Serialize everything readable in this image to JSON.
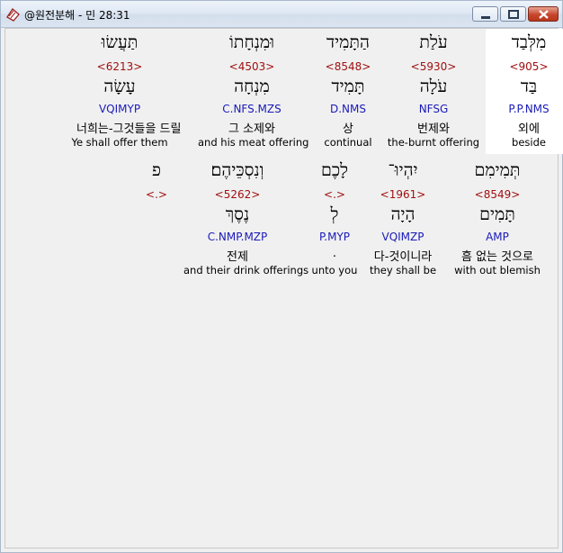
{
  "window": {
    "title": "@원전분해 - 민 28:31"
  },
  "row1": [
    {
      "heb": "מִלְּבַד",
      "num": "<905>",
      "lemma": "בַּד",
      "gram": "P.P.NMS",
      "kor": "외에",
      "eng": "beside"
    },
    {
      "heb": "עֹלַת",
      "num": "<5930>",
      "lemma": "עֹלָה",
      "gram": "NFSG",
      "kor": "번제와",
      "eng": "the-burnt offering"
    },
    {
      "heb": "הַתָּמִיד",
      "num": "<8548>",
      "lemma": "תָּמִיד",
      "gram": "D.NMS",
      "kor": "상",
      "eng": "continual"
    },
    {
      "heb": "וּמִנְחָתוֹ",
      "num": "<4503>",
      "lemma": "מִנְחָה",
      "gram": "C.NFS.MZS",
      "kor": "그 소제와",
      "eng": "and his meat offering"
    },
    {
      "heb": "תַּעֲשׂוּ",
      "num": "<6213>",
      "lemma": "עָשָׂה",
      "gram": "VQIMYP",
      "kor": "너희는-그것들을 드릴",
      "eng": "Ye shall offer them"
    }
  ],
  "row2": [
    {
      "heb": "תְּמִימִם",
      "num": "<8549>",
      "lemma": "תָּמִים",
      "gram": "AMP",
      "kor": "흠 없는 것으로",
      "eng": "with out blemish"
    },
    {
      "heb": "יִהְיוּ־",
      "num": "<1961>",
      "lemma": "הָיָה",
      "gram": "VQIMZP",
      "kor": "다-것이니라",
      "eng": "they shall be"
    },
    {
      "heb": "לָכֶם",
      "num": "<.>",
      "lemma": "לְ",
      "gram": "P.MYP",
      "kor": ".",
      "eng": "unto you"
    },
    {
      "heb": "וְנִסְכֵּיהֶם׃",
      "num": "<5262>",
      "lemma": "נֶסֶךְ",
      "gram": "C.NMP.MZP",
      "kor": "전제",
      "eng": "and their drink offerings"
    },
    {
      "heb": "פ",
      "num": "<.>",
      "lemma": "",
      "gram": "",
      "kor": "",
      "eng": ""
    }
  ],
  "icons": {
    "app": "scroll-book-icon",
    "minimize": "minimize-icon",
    "maximize": "maximize-icon",
    "close": "close-icon"
  },
  "colors": {
    "strong_number": "#a01010",
    "grammar_code": "#1a1ab8",
    "selected_word_bg": "#ffffff",
    "close_button": "#c8462d"
  }
}
